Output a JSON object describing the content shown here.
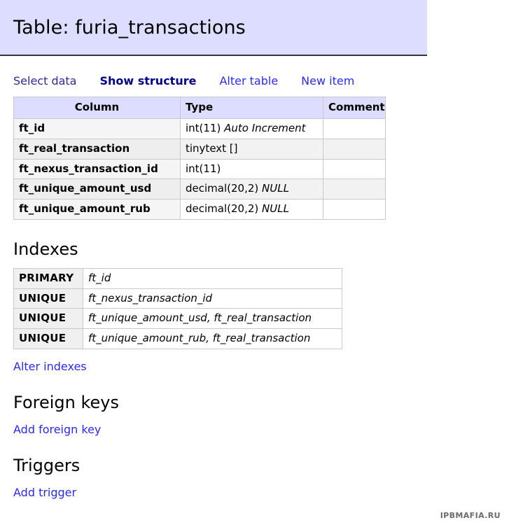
{
  "header": {
    "title": "Table: furia_transactions"
  },
  "nav": {
    "items": [
      {
        "label": "Select data",
        "state": "visited"
      },
      {
        "label": "Show structure",
        "state": "current"
      },
      {
        "label": "Alter table",
        "state": "link"
      },
      {
        "label": "New item",
        "state": "link"
      }
    ]
  },
  "structure": {
    "headers": [
      "Column",
      "Type",
      "Comment"
    ],
    "rows": [
      {
        "column": "ft_id",
        "type": "int(11) ",
        "type_flag": "Auto Increment",
        "comment": ""
      },
      {
        "column": "ft_real_transaction",
        "type": "tinytext []",
        "type_flag": "",
        "comment": ""
      },
      {
        "column": "ft_nexus_transaction_id",
        "type": "int(11)",
        "type_flag": "",
        "comment": ""
      },
      {
        "column": "ft_unique_amount_usd",
        "type": "decimal(20,2) ",
        "type_flag": "NULL",
        "comment": ""
      },
      {
        "column": "ft_unique_amount_rub",
        "type": "decimal(20,2) ",
        "type_flag": "NULL",
        "comment": ""
      }
    ]
  },
  "indexes": {
    "heading": "Indexes",
    "rows": [
      {
        "kind": "PRIMARY",
        "columns": "ft_id"
      },
      {
        "kind": "UNIQUE",
        "columns": "ft_nexus_transaction_id"
      },
      {
        "kind": "UNIQUE",
        "columns": "ft_unique_amount_usd, ft_real_transaction"
      },
      {
        "kind": "UNIQUE",
        "columns": "ft_unique_amount_rub, ft_real_transaction"
      }
    ],
    "alter_link": "Alter indexes"
  },
  "foreign_keys": {
    "heading": "Foreign keys",
    "add_link": "Add foreign key"
  },
  "triggers": {
    "heading": "Triggers",
    "add_link": "Add trigger"
  },
  "watermark": {
    "text": "IPBMAFIA.RU"
  },
  "colors": {
    "header_band": "#ddddff",
    "link": "#2a2af5",
    "link_visited": "#2b2b8f",
    "current_tab": "#00008b",
    "table_header": "#ddddff",
    "row_alt": "#f2f2f2"
  }
}
